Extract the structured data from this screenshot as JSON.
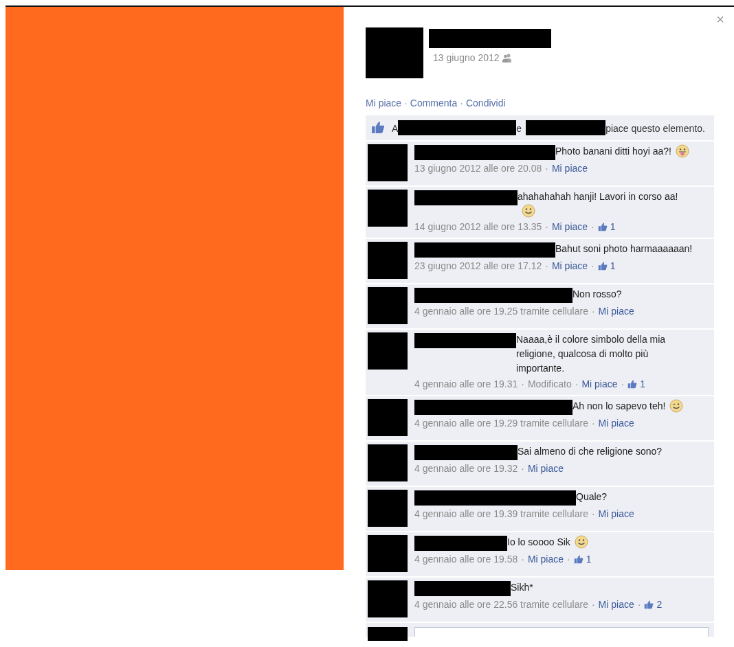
{
  "close": "×",
  "post": {
    "date": "13 giugno 2012",
    "separator": "·",
    "actions": [
      {
        "label": "Mi piace"
      },
      {
        "label": "Commenta"
      },
      {
        "label": "Condividi"
      }
    ]
  },
  "likes_summary": {
    "parts": [
      "A",
      "e",
      "piace questo elemento."
    ]
  },
  "comments": [
    {
      "text": "Photo banani ditti hoyi aa?!",
      "emoji": {
        "kind": "tongue"
      },
      "time": "13 giugno 2012 alle ore 20.08",
      "like_link": "Mi piace"
    },
    {
      "text": "ahahahahah hanji! Lavori in corso aa!",
      "emoji": {
        "kind": "smile"
      },
      "time": "14 giugno 2012 alle ore 13.35",
      "like_link": "Mi piace",
      "likes": "1"
    },
    {
      "text": "Bahut soni photo harmaaaaaan!",
      "time": "23 giugno 2012 alle ore 17.12",
      "like_link": "Mi piace",
      "likes": "1"
    },
    {
      "text": "Non rosso?",
      "time": "4 gennaio alle ore 19.25 tramite cellulare",
      "like_link": "Mi piace"
    },
    {
      "text": "Naaaa,è il colore simbolo della mia religione, qualcosa di molto più importante.",
      "time": "4 gennaio alle ore 19.31",
      "edited": "Modificato",
      "like_link": "Mi piace",
      "likes": "1"
    },
    {
      "text": "Ah non lo sapevo teh!",
      "emoji": {
        "kind": "wink"
      },
      "time": "4 gennaio alle ore 19.29 tramite cellulare",
      "like_link": "Mi piace"
    },
    {
      "text": "Sai almeno di che religione sono?",
      "time": "4 gennaio alle ore 19.32",
      "like_link": "Mi piace"
    },
    {
      "text": "Quale?",
      "time": "4 gennaio alle ore 19.39 tramite cellulare",
      "like_link": "Mi piace"
    },
    {
      "text": "Io lo soooo Sik",
      "emoji": {
        "kind": "smile"
      },
      "time": "4 gennaio alle ore 19.58",
      "like_link": "Mi piace",
      "likes": "1"
    },
    {
      "text": "Sikh*",
      "time": "4 gennaio alle ore 22.56 tramite cellulare",
      "like_link": "Mi piace",
      "likes": "2"
    }
  ]
}
